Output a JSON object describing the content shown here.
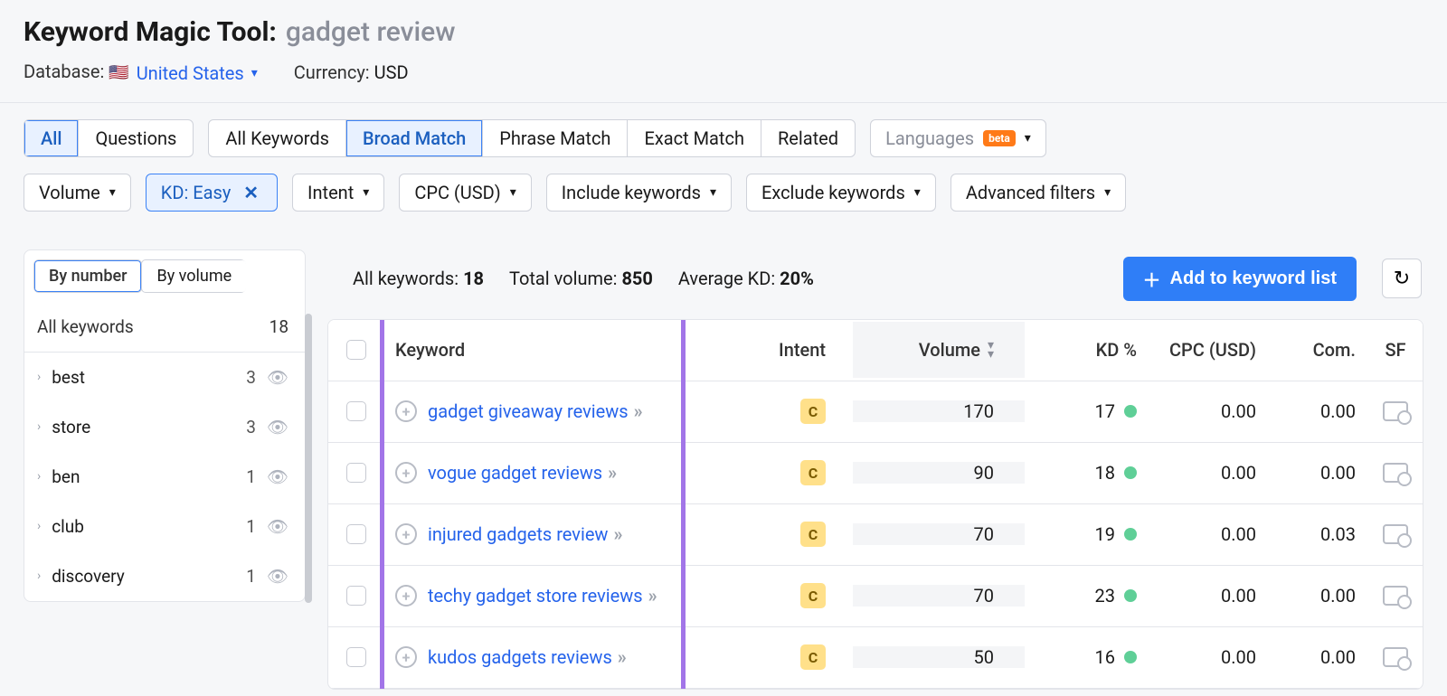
{
  "header": {
    "tool_name": "Keyword Magic Tool:",
    "query": "gadget review",
    "database_label": "Database:",
    "database_value": "United States",
    "currency_label": "Currency:",
    "currency_value": "USD"
  },
  "filter_segments": {
    "scope": [
      "All",
      "Questions"
    ],
    "scope_selected": "All",
    "match": [
      "All Keywords",
      "Broad Match",
      "Phrase Match",
      "Exact Match",
      "Related"
    ],
    "match_selected": "Broad Match",
    "languages_label": "Languages",
    "languages_badge": "beta"
  },
  "filter_pills": {
    "volume": "Volume",
    "kd": "KD: Easy",
    "intent": "Intent",
    "cpc": "CPC (USD)",
    "include": "Include keywords",
    "exclude": "Exclude keywords",
    "advanced": "Advanced filters"
  },
  "sidebar": {
    "tabs": [
      "By number",
      "By volume"
    ],
    "tab_selected": "By number",
    "all_label": "All keywords",
    "all_count": 18,
    "groups": [
      {
        "name": "best",
        "count": 3
      },
      {
        "name": "store",
        "count": 3
      },
      {
        "name": "ben",
        "count": 1
      },
      {
        "name": "club",
        "count": 1
      },
      {
        "name": "discovery",
        "count": 1
      }
    ]
  },
  "summary": {
    "all_label": "All keywords:",
    "all_value": "18",
    "total_label": "Total volume:",
    "total_value": "850",
    "avg_label": "Average KD:",
    "avg_value": "20%",
    "add_button": "Add to keyword list"
  },
  "table": {
    "headers": {
      "keyword": "Keyword",
      "intent": "Intent",
      "volume": "Volume",
      "kd": "KD %",
      "cpc": "CPC (USD)",
      "com": "Com.",
      "sf": "SF"
    },
    "rows": [
      {
        "keyword": "gadget giveaway reviews",
        "intent": "C",
        "volume": "170",
        "kd": "17",
        "cpc": "0.00",
        "com": "0.00"
      },
      {
        "keyword": "vogue gadget reviews",
        "intent": "C",
        "volume": "90",
        "kd": "18",
        "cpc": "0.00",
        "com": "0.00"
      },
      {
        "keyword": "injured gadgets review",
        "intent": "C",
        "volume": "70",
        "kd": "19",
        "cpc": "0.00",
        "com": "0.03"
      },
      {
        "keyword": "techy gadget store reviews",
        "intent": "C",
        "volume": "70",
        "kd": "23",
        "cpc": "0.00",
        "com": "0.00"
      },
      {
        "keyword": "kudos gadgets reviews",
        "intent": "C",
        "volume": "50",
        "kd": "16",
        "cpc": "0.00",
        "com": "0.00"
      }
    ]
  }
}
